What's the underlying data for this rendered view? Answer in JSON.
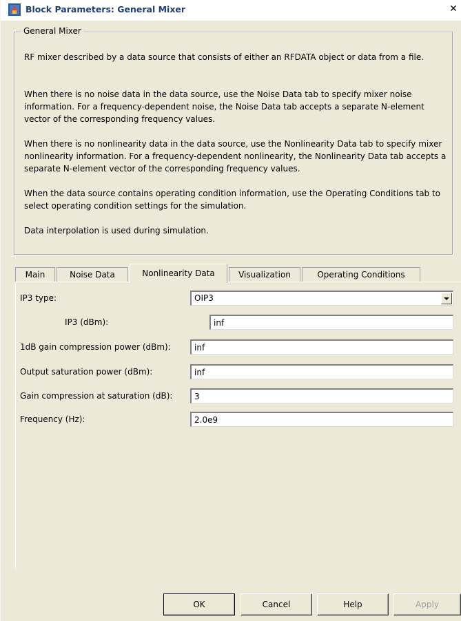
{
  "window": {
    "title": "Block Parameters: General Mixer",
    "close_glyph": "✕"
  },
  "group": {
    "legend": "General Mixer",
    "paragraphs": [
      "RF mixer described by a data source that consists of either an RFDATA object or data from a file.",
      "When there is no noise data in the data source, use the Noise Data tab to specify mixer noise information. For a frequency-dependent noise, the Noise Data tab accepts a separate N-element vector of the corresponding frequency values.",
      "When there is no nonlinearity data in the data source, use the Nonlinearity Data tab to specify mixer nonlinearity information. For a frequency-dependent nonlinearity, the Nonlinearity Data tab accepts a separate N-element vector of the corresponding frequency values.",
      "When the data source contains operating condition information, use the Operating Conditions tab to select operating condition settings for the simulation.",
      "Data interpolation is used during simulation."
    ]
  },
  "tabs": [
    {
      "label": "Main"
    },
    {
      "label": "Noise Data"
    },
    {
      "label": "Nonlinearity Data"
    },
    {
      "label": "Visualization"
    },
    {
      "label": "Operating Conditions"
    }
  ],
  "active_tab": "Nonlinearity Data",
  "form": {
    "ip3_type_label": "IP3 type:",
    "ip3_type_value": "OIP3",
    "ip3_label": "IP3 (dBm):",
    "ip3_value": "inf",
    "p1db_label": "1dB gain compression power (dBm):",
    "p1db_value": "inf",
    "psat_label": "Output saturation power (dBm):",
    "psat_value": "inf",
    "gcsat_label": "Gain compression at saturation (dB):",
    "gcsat_value": "3",
    "freq_label": "Frequency (Hz):",
    "freq_value": "2.0e9"
  },
  "buttons": {
    "ok": "OK",
    "cancel": "Cancel",
    "help": "Help",
    "apply": "Apply"
  },
  "colors": {
    "title_text": "#1f3f7a",
    "window_bg": "#ece9d8",
    "disabled_text": "#a0a0a0"
  }
}
